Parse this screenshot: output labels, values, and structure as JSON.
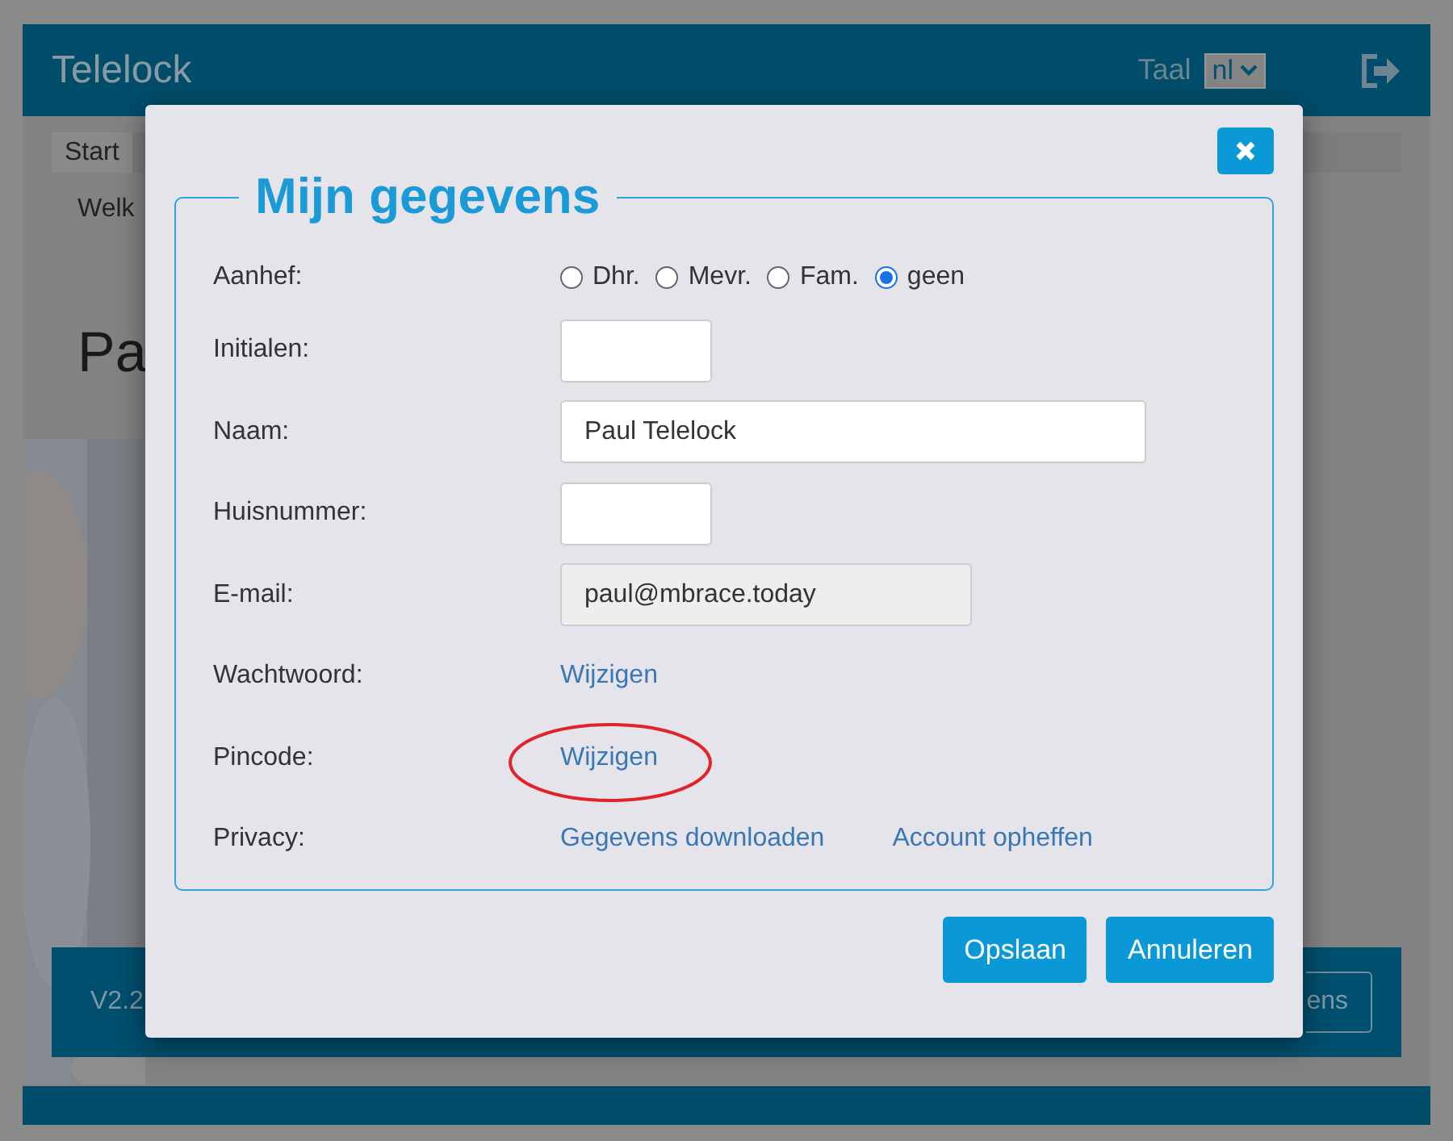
{
  "app": {
    "title": "Telelock",
    "language_label": "Taal",
    "language": "nl",
    "tab": "Start",
    "welcome": "Welk",
    "heading": "Pa",
    "version": "V2.2",
    "footer_button": "ens"
  },
  "dialog": {
    "title": "Mijn gegevens",
    "fields": [
      {
        "kind": "radio",
        "label": "Aanhef:",
        "options": [
          {
            "label": "Dhr.",
            "selected": false
          },
          {
            "label": "Mevr.",
            "selected": false
          },
          {
            "label": "Fam.",
            "selected": false
          },
          {
            "label": "geen",
            "selected": true
          }
        ]
      },
      {
        "kind": "short_input",
        "label": "Initialen:"
      },
      {
        "kind": "input",
        "label": "Naam:",
        "value": "Paul Telelock"
      },
      {
        "kind": "short_input",
        "label": "Huisnummer:"
      },
      {
        "kind": "readonly_input",
        "label": "E-mail:",
        "value": "paul@mbrace.today"
      },
      {
        "kind": "links",
        "label": "Wachtwoord:",
        "links": [
          {
            "text": "Wijzigen",
            "circled": false
          }
        ]
      },
      {
        "kind": "links",
        "label": "Pincode:",
        "links": [
          {
            "text": "Wijzigen",
            "circled": true
          }
        ]
      },
      {
        "kind": "links",
        "label": "Privacy:",
        "links": [
          {
            "text": "Gegevens downloaden",
            "circled": false
          },
          {
            "text": "Account opheffen",
            "circled": false
          }
        ]
      }
    ],
    "buttons": [
      {
        "label": "Opslaan"
      },
      {
        "label": "Annuleren"
      }
    ]
  }
}
